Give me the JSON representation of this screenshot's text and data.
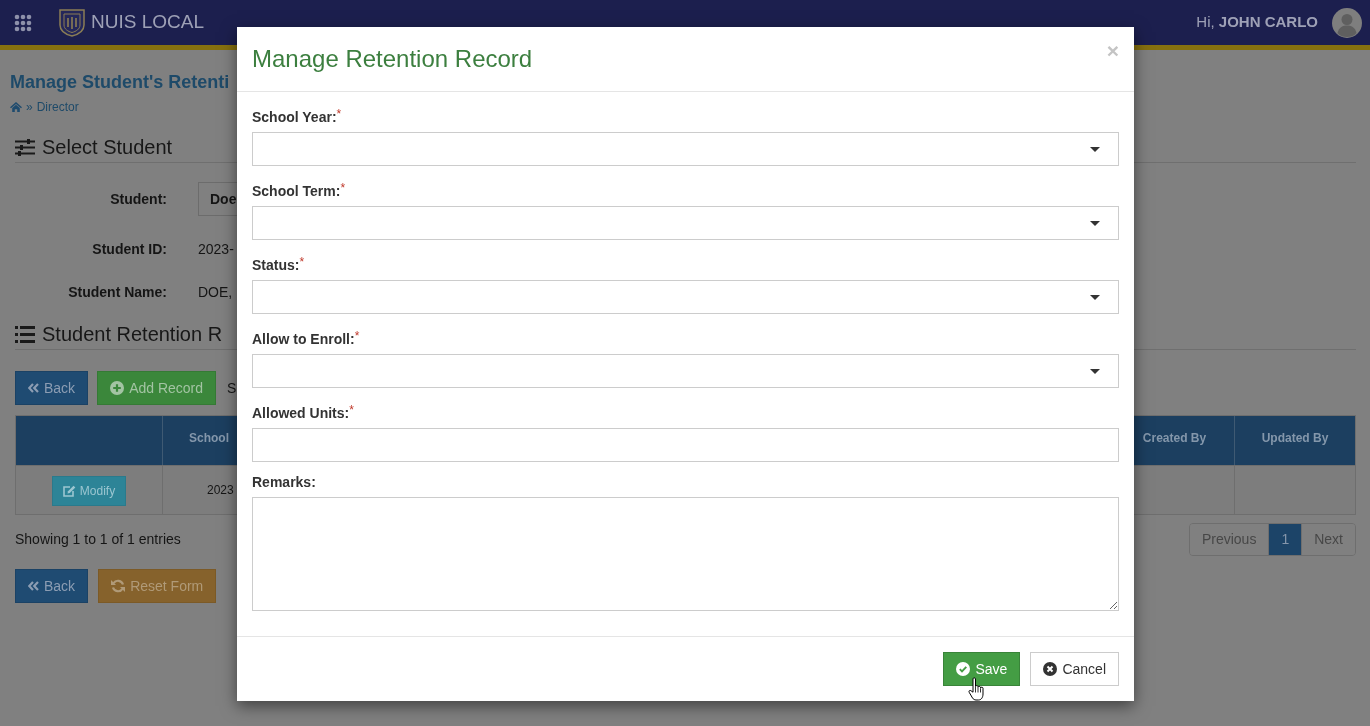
{
  "navbar": {
    "app_name": "NUIS LOCAL",
    "greeting": "Hi, **JOHN CARLO**"
  },
  "page": {
    "title": "Manage Student's Retenti",
    "breadcrumb": {
      "separator": "»",
      "items": [
        "Director"
      ]
    },
    "select_student": {
      "heading": "Select Student",
      "fields": [
        {
          "kind": "select",
          "label": "Student:",
          "value": "Doe"
        },
        {
          "kind": "text",
          "label": "Student ID:",
          "value": "2023-"
        },
        {
          "kind": "text",
          "label": "Student Name:",
          "value": "DOE,"
        }
      ]
    },
    "retention_records": {
      "heading": "Student Retention R",
      "buttons": [
        {
          "kind": "back",
          "label": "Back"
        },
        {
          "kind": "add",
          "label": "Add Record"
        }
      ],
      "length_label": "S",
      "table": {
        "columns_start": [
          "School"
        ],
        "columns_end": [
          "Created By",
          "Updated By"
        ],
        "rows": [
          {
            "action": "Modify",
            "column_2": "2023"
          }
        ]
      },
      "info": "Showing 1 to 1 of 1 entries",
      "pagination": [
        {
          "label": "Previous",
          "selected": false
        },
        {
          "label": "1",
          "selected": true
        },
        {
          "label": "Next",
          "selected": false
        }
      ]
    },
    "footer_buttons": [
      {
        "kind": "back",
        "label": "Back"
      },
      {
        "kind": "reset",
        "label": "Reset Form"
      }
    ]
  },
  "modal": {
    "title": "Manage Retention Record",
    "close": "×",
    "required_mark": "*",
    "fields": [
      {
        "kind": "select",
        "label": "School Year:",
        "required": true
      },
      {
        "kind": "select",
        "label": "School Term:",
        "required": true
      },
      {
        "kind": "select",
        "label": "Status:",
        "required": true
      },
      {
        "kind": "select",
        "label": "Allow to Enroll:",
        "required": true
      },
      {
        "kind": "text",
        "label": "Allowed Units:",
        "required": true
      },
      {
        "kind": "textarea",
        "label": "Remarks:",
        "required": false
      }
    ],
    "buttons": [
      {
        "kind": "save",
        "label": "Save"
      },
      {
        "kind": "cancel",
        "label": "Cancel"
      }
    ]
  }
}
